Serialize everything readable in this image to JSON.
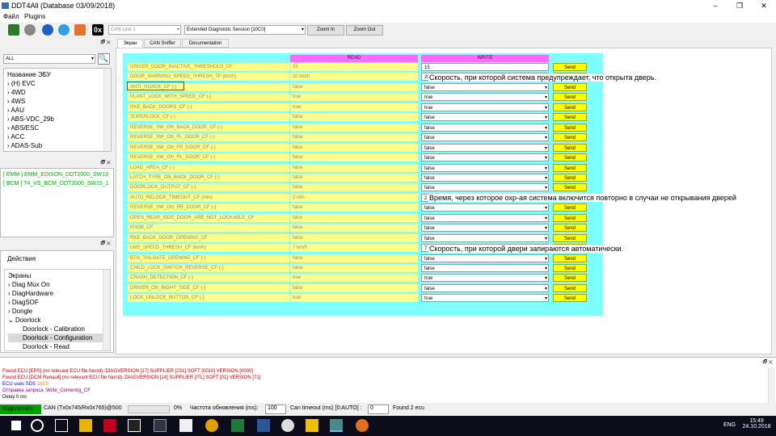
{
  "window": {
    "title": "DDT4All (Database 03/09/2018)",
    "controls": [
      "–",
      "❐",
      "✕"
    ]
  },
  "menu": {
    "file": "Файл",
    "plugins": "Plugins"
  },
  "toolbar": {
    "can_line": "CAN Line 1",
    "session": "Extended Diagnostic Session [10C0]",
    "zoom_in": "Zoom In",
    "zoom_out": "Zoom Out",
    "hex_label": "0x"
  },
  "left": {
    "filter": "ALL",
    "ecu_header": "Название ЭБУ",
    "ecus": [
      "(H) EVC",
      "4WD",
      "4WS",
      "AAU",
      "ABS-VDC_29b",
      "ABS/ESC",
      "ACC",
      "ADAS-Sub"
    ],
    "found": [
      "[ EMM ] EMM_EDISON_DDT2000_SW13",
      "[ BCM ] T4_VS_BCM_DDT2000_SW15_1"
    ],
    "actions_header": "Действия",
    "screens_header": "Экраны",
    "screens": [
      "Diag Mux On",
      "DiagHardware",
      "DiagSOF",
      "Dongle",
      "Doorlock",
      "Doorlock - Calibration",
      "Doorlock - Configuration",
      "Doorlock - Read"
    ]
  },
  "tabs": [
    "Экран",
    "CAN Sniffer",
    "Documentation"
  ],
  "grid": {
    "read_header": "READ",
    "write_header": "WRITE",
    "send_label": "Send",
    "rows": [
      {
        "name": "DRIVER_DOOR_INACTIVE_THRESHOLD_CF",
        "read": "15",
        "write": "15",
        "dropdown": false
      },
      {
        "name": "DOOR_WARNING_SPEED_THRESH_TP (km/h)",
        "read": "20 km/h",
        "write": "20",
        "dropdown": false
      },
      {
        "name": "ANTI_HIJACK_CF (-)",
        "read": "false",
        "write": "false",
        "dropdown": true
      },
      {
        "name": "PLANT_LOCK_WITH_SPEED_CF (-)",
        "read": "true",
        "write": "true",
        "dropdown": true
      },
      {
        "name": "RKE_BACK_DOORS_CF (-)",
        "read": "true",
        "write": "true",
        "dropdown": true
      },
      {
        "name": "SUPERLOCK_CF (-)",
        "read": "false",
        "write": "false",
        "dropdown": true
      },
      {
        "name": "REVERSE_SW_ON_BACK_DOOR_CF (-)",
        "read": "false",
        "write": "false",
        "dropdown": true
      },
      {
        "name": "REVERSE_SW_ON_FL_DOOR_CF (-)",
        "read": "false",
        "write": "false",
        "dropdown": true
      },
      {
        "name": "REVERSE_SW_ON_FR_DOOR_CF (-)",
        "read": "false",
        "write": "false",
        "dropdown": true
      },
      {
        "name": "REVERSE_SW_ON_RL_DOOR_CF (-)",
        "read": "false",
        "write": "false",
        "dropdown": true
      },
      {
        "name": "LOAD_AREA_CF (-)",
        "read": "false",
        "write": "false",
        "dropdown": true
      },
      {
        "name": "LATCH_TYPE_ON_BACK_DOOR_CF (-)",
        "read": "false",
        "write": "false",
        "dropdown": true
      },
      {
        "name": "DOORLOCK_OUTPUT_CF (-)",
        "read": "false",
        "write": "false",
        "dropdown": true
      },
      {
        "name": "AUTO_RELOCK_TIMEOUT_CF (min)",
        "read": "2 min",
        "write": "2",
        "dropdown": false
      },
      {
        "name": "REVERSE_SW_ON_RR_DOOR_CF (-)",
        "read": "false",
        "write": "false",
        "dropdown": true
      },
      {
        "name": "OPEN_REAR_SIDE_DOOR_ARE_NOT_LOCKABLE_CF",
        "read": "false",
        "write": "false",
        "dropdown": true
      },
      {
        "name": "KNOB_CF",
        "read": "false",
        "write": "false",
        "dropdown": true
      },
      {
        "name": "RKE_BACK_DOOR_OPENING_CF",
        "read": "false",
        "write": "false",
        "dropdown": true
      },
      {
        "name": "LWS_SPEED_THRESH_CF (km/h)",
        "read": "7 km/h",
        "write": "7",
        "dropdown": false
      },
      {
        "name": "BTN_TAILGATE_OPENING_CF (-)",
        "read": "false",
        "write": "false",
        "dropdown": true
      },
      {
        "name": "CHILD_LOCK_SWITCH_REVERSE_CF (-)",
        "read": "false",
        "write": "false",
        "dropdown": true
      },
      {
        "name": "CRASH_DETECTION_CF (-)",
        "read": "true",
        "write": "true",
        "dropdown": true
      },
      {
        "name": "DRIVER_ON_RIGHT_SIDE_CF (-)",
        "read": "false",
        "write": "false",
        "dropdown": true
      },
      {
        "name": "LOCK_UNLOCK_BUTTON_CF (-)",
        "read": "true",
        "write": "true",
        "dropdown": true
      }
    ],
    "annotations": [
      "Скорость, при которой система предупреждает, что открыта дверь.",
      "Время, через которое охр-ая система включится повторно в случаи не открывания дверей",
      "Скорость, при которой двери запираются автоматически."
    ]
  },
  "log": [
    {
      "text": "Found ECU [EPS] (no relevant ECU file found) :DIAGVERSION [17] SUPPLIER [231] SOFT [0010] VERSION [0000]",
      "color": "#c00000"
    },
    {
      "text": "Found ECU [DCM Renault] (no relevant ECU file found) :DIAGVERSION [14] SUPPLIER [ITL] SOFT [01] VERSION [71]",
      "color": "#c00000"
    },
    {
      "text": "ECU uses SDS ",
      "color": "#0000c0",
      "extra": "10C0"
    },
    {
      "text": "Отправка запроса :Write_Cornering_CF",
      "color": "#800080"
    },
    {
      "text": "Delay 0 ms",
      "color": "#000"
    }
  ],
  "status": {
    "connected": "ПОДКЛЮЧЕН",
    "can": "CAN (Tx0x745/Rx0x765)@500",
    "percent": "0%",
    "refresh_label": "Частота обновления (ms):",
    "refresh": "100",
    "timeout_label": "Can timeout (ms) [0:AUTO] :",
    "timeout": "0",
    "found": "Found 2 ecu"
  },
  "taskbar": {
    "lang": "ENG",
    "time": "15:49",
    "date": "24.10.2018"
  },
  "colors": {
    "grid_bg": "#7fffff",
    "header": "#ff6bff",
    "cell": "#ffff8a",
    "send": "#ffff00",
    "status_green": "#00a000"
  }
}
